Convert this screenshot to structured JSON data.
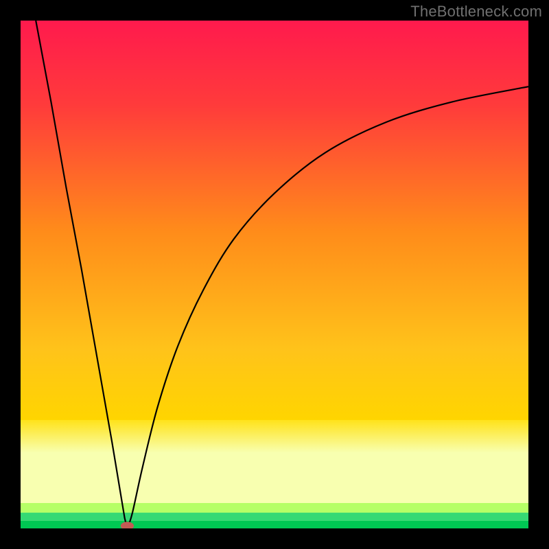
{
  "watermark": "TheBottleneck.com",
  "chart_data": {
    "type": "line",
    "title": "",
    "xlabel": "",
    "ylabel": "",
    "xlim": [
      0,
      100
    ],
    "ylim": [
      0,
      100
    ],
    "grid": false,
    "legend": false,
    "background": {
      "top_color": "#ff1a4d",
      "mid_color": "#ffd500",
      "bottom_band_color": "#f8ffb0",
      "baseline_colors": [
        "#b6ff66",
        "#35d974",
        "#00c853"
      ]
    },
    "curve": {
      "description": "V-shaped bottleneck curve with vertex near x≈21, rising steeply left and asymptotically toward ~87 on the right",
      "vertex_x": 21,
      "vertex_y": 0,
      "left_endpoint": {
        "x": 3,
        "y": 100
      },
      "right_endpoint": {
        "x": 100,
        "y": 87
      },
      "samples_left": [
        {
          "x": 3,
          "y": 100
        },
        {
          "x": 6,
          "y": 84
        },
        {
          "x": 9,
          "y": 67
        },
        {
          "x": 12,
          "y": 51
        },
        {
          "x": 15,
          "y": 34
        },
        {
          "x": 18,
          "y": 17
        },
        {
          "x": 20.5,
          "y": 2
        },
        {
          "x": 21,
          "y": 0
        }
      ],
      "samples_right": [
        {
          "x": 21,
          "y": 0
        },
        {
          "x": 22,
          "y": 3
        },
        {
          "x": 24,
          "y": 12
        },
        {
          "x": 27,
          "y": 24
        },
        {
          "x": 31,
          "y": 36
        },
        {
          "x": 36,
          "y": 47
        },
        {
          "x": 42,
          "y": 57
        },
        {
          "x": 50,
          "y": 66
        },
        {
          "x": 60,
          "y": 74
        },
        {
          "x": 72,
          "y": 80
        },
        {
          "x": 85,
          "y": 84
        },
        {
          "x": 100,
          "y": 87
        }
      ]
    },
    "marker": {
      "x": 21,
      "y": 0.5,
      "rx": 1.3,
      "ry": 0.8,
      "fill": "#c25b54"
    }
  }
}
